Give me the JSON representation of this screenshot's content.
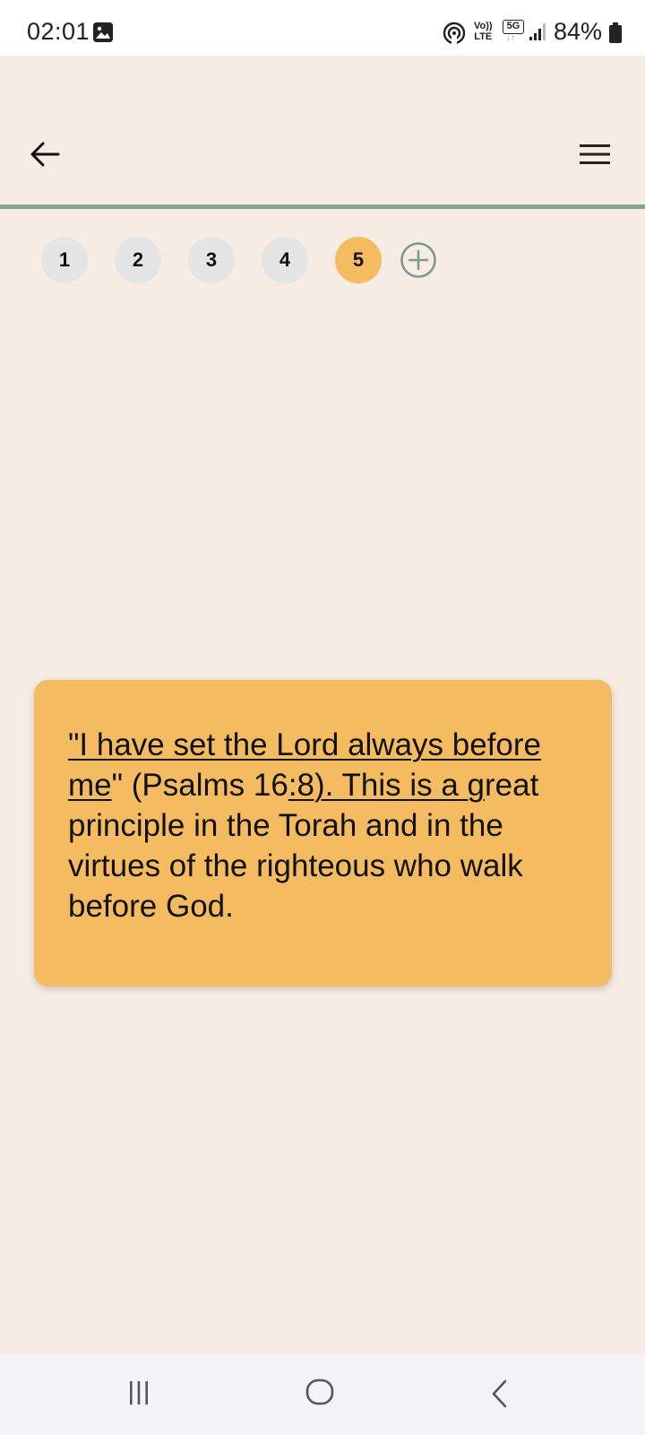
{
  "status_bar": {
    "time": "02:01",
    "volte_top": "Vo))",
    "volte_bottom": "LTE",
    "network": "5G",
    "battery": "84%"
  },
  "header": {
    "back_icon": "arrow-left-icon",
    "menu_icon": "hamburger-menu-icon",
    "divider_color": "#86a397"
  },
  "tabs": {
    "items": [
      "1",
      "2",
      "3",
      "4",
      "5"
    ],
    "active_index": 4,
    "active_color": "#f5bb60",
    "add_icon": "plus-circle-icon"
  },
  "card": {
    "background": "#f5bb60",
    "text_parts": [
      "\"I have set",
      " the Lord always before",
      " me",
      "\" (Psalms 16",
      ":8). This is a ",
      "g",
      "reat",
      " principle in the Torah and in the virtues of the righteous who walk before God."
    ]
  },
  "navbar": {
    "recents_icon": "recents-icon",
    "home_icon": "home-icon",
    "back_icon": "back-chevron-icon"
  }
}
